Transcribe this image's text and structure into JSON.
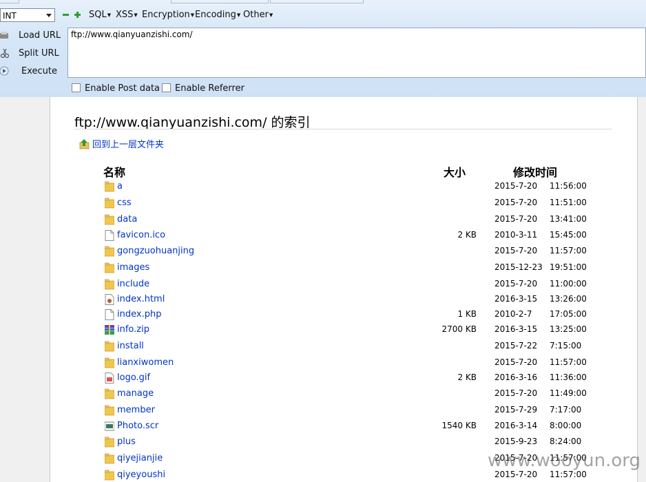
{
  "toolbar": {
    "select_value": "INT",
    "menus": [
      "SQL",
      "XSS",
      "Encryption",
      "Encoding",
      "Other"
    ],
    "load_url": "Load URL",
    "split_url": "Split URL",
    "execute": "Execute",
    "url_value": "ftp://www.qianyuanzishi.com/",
    "enable_post": "Enable Post data",
    "enable_referrer": "Enable Referrer"
  },
  "listing": {
    "title": "ftp://www.qianyuanzishi.com/ 的索引",
    "up_link": "回到上一层文件夹",
    "col_name": "名称",
    "col_size": "大小",
    "col_modified": "修改时间",
    "rows": [
      {
        "icon": "folder-icon",
        "name": "a",
        "size": "",
        "date": "2015-7-20",
        "time": "11:56:00"
      },
      {
        "icon": "folder-icon",
        "name": "css",
        "size": "",
        "date": "2015-7-20",
        "time": "11:51:00"
      },
      {
        "icon": "folder-icon",
        "name": "data",
        "size": "",
        "date": "2015-7-20",
        "time": "13:41:00"
      },
      {
        "icon": "file-icon",
        "name": "favicon.ico",
        "size": "2 KB",
        "date": "2010-3-11",
        "time": "15:45:00"
      },
      {
        "icon": "folder-icon",
        "name": "gongzuohuanjing",
        "size": "",
        "date": "2015-7-20",
        "time": "11:57:00"
      },
      {
        "icon": "folder-icon",
        "name": "images",
        "size": "",
        "date": "2015-12-23",
        "time": "19:51:00"
      },
      {
        "icon": "folder-icon",
        "name": "include",
        "size": "",
        "date": "2015-7-20",
        "time": "11:00:00"
      },
      {
        "icon": "html-file-icon",
        "name": "index.html",
        "size": "",
        "date": "2016-3-15",
        "time": "13:26:00"
      },
      {
        "icon": "file-icon",
        "name": "index.php",
        "size": "1 KB",
        "date": "2010-2-7",
        "time": "17:05:00"
      },
      {
        "icon": "zip-file-icon",
        "name": "info.zip",
        "size": "2700 KB",
        "date": "2016-3-15",
        "time": "13:25:00"
      },
      {
        "icon": "folder-icon",
        "name": "install",
        "size": "",
        "date": "2015-7-22",
        "time": "7:15:00"
      },
      {
        "icon": "folder-icon",
        "name": "lianxiwomen",
        "size": "",
        "date": "2015-7-20",
        "time": "11:57:00"
      },
      {
        "icon": "image-file-icon",
        "name": "logo.gif",
        "size": "2 KB",
        "date": "2016-3-16",
        "time": "11:36:00"
      },
      {
        "icon": "folder-icon",
        "name": "manage",
        "size": "",
        "date": "2015-7-20",
        "time": "11:49:00"
      },
      {
        "icon": "folder-icon",
        "name": "member",
        "size": "",
        "date": "2015-7-29",
        "time": "7:17:00"
      },
      {
        "icon": "screensaver-file-icon",
        "name": "Photo.scr",
        "size": "1540 KB",
        "date": "2016-3-14",
        "time": "8:00:00"
      },
      {
        "icon": "folder-icon",
        "name": "plus",
        "size": "",
        "date": "2015-9-23",
        "time": "8:24:00"
      },
      {
        "icon": "folder-icon",
        "name": "qiyejianjie",
        "size": "",
        "date": "2015-7-20",
        "time": "11:57:00"
      },
      {
        "icon": "folder-icon",
        "name": "qiyeyoushi",
        "size": "",
        "date": "2015-7-20",
        "time": "11:57:00"
      }
    ]
  },
  "watermark": "www.wooyun.org"
}
